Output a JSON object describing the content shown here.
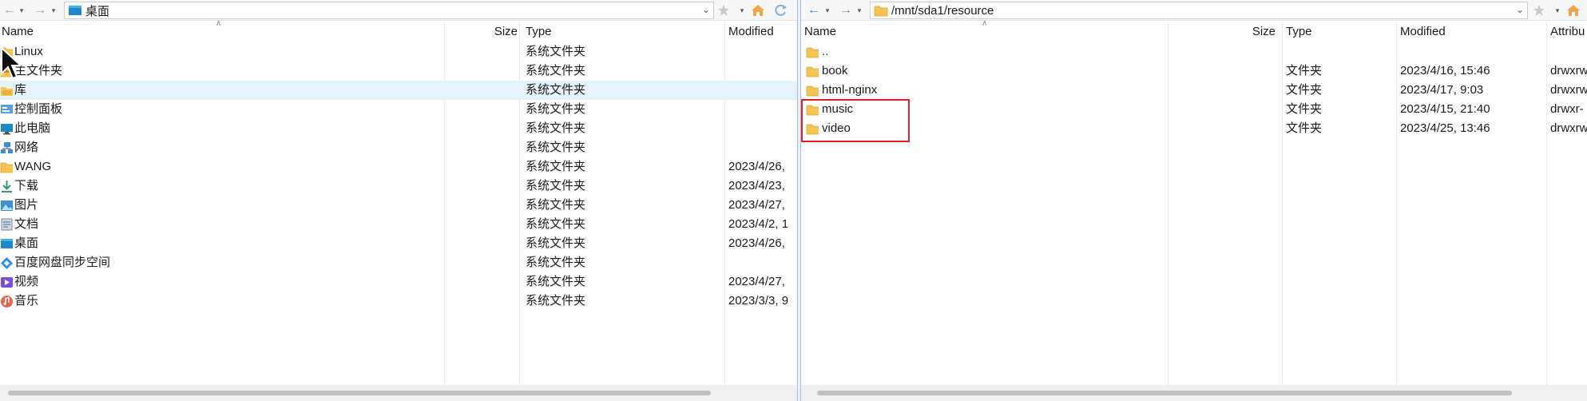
{
  "left": {
    "address": "桌面",
    "columns": {
      "name": "Name",
      "size": "Size",
      "type": "Type",
      "modified": "Modified"
    },
    "rows": [
      {
        "name": "Linux",
        "size": "",
        "type": "系统文件夹",
        "modified": "",
        "icon": "folder-icon"
      },
      {
        "name": "主文件夹",
        "size": "",
        "type": "系统文件夹",
        "modified": "",
        "icon": "home-folder-icon"
      },
      {
        "name": "库",
        "size": "",
        "type": "系统文件夹",
        "modified": "",
        "icon": "library-icon"
      },
      {
        "name": "控制面板",
        "size": "",
        "type": "系统文件夹",
        "modified": "",
        "icon": "control-panel-icon"
      },
      {
        "name": "此电脑",
        "size": "",
        "type": "系统文件夹",
        "modified": "",
        "icon": "computer-icon"
      },
      {
        "name": "网络",
        "size": "",
        "type": "系统文件夹",
        "modified": "",
        "icon": "network-icon"
      },
      {
        "name": "WANG",
        "size": "",
        "type": "系统文件夹",
        "modified": "2023/4/26,",
        "icon": "folder-icon"
      },
      {
        "name": "下载",
        "size": "",
        "type": "系统文件夹",
        "modified": "2023/4/23,",
        "icon": "download-icon"
      },
      {
        "name": "图片",
        "size": "",
        "type": "系统文件夹",
        "modified": "2023/4/27,",
        "icon": "pictures-icon"
      },
      {
        "name": "文档",
        "size": "",
        "type": "系统文件夹",
        "modified": "2023/4/2, 1",
        "icon": "documents-icon"
      },
      {
        "name": "桌面",
        "size": "",
        "type": "系统文件夹",
        "modified": "2023/4/26,",
        "icon": "desktop-icon"
      },
      {
        "name": "百度网盘同步空间",
        "size": "",
        "type": "系统文件夹",
        "modified": "",
        "icon": "baidu-netdisk-icon"
      },
      {
        "name": "视频",
        "size": "",
        "type": "系统文件夹",
        "modified": "2023/4/27,",
        "icon": "videos-icon"
      },
      {
        "name": "音乐",
        "size": "",
        "type": "系统文件夹",
        "modified": "2023/3/3, 9",
        "icon": "music-icon"
      }
    ]
  },
  "right": {
    "address": "/mnt/sda1/resource",
    "columns": {
      "name": "Name",
      "size": "Size",
      "type": "Type",
      "modified": "Modified",
      "attributes": "Attribu"
    },
    "rows": [
      {
        "name": "..",
        "size": "",
        "type": "",
        "modified": "",
        "attributes": ""
      },
      {
        "name": "book",
        "size": "",
        "type": "文件夹",
        "modified": "2023/4/16, 15:46",
        "attributes": "drwxrw"
      },
      {
        "name": "html-nginx",
        "size": "",
        "type": "文件夹",
        "modified": "2023/4/17, 9:03",
        "attributes": "drwxrw"
      },
      {
        "name": "music",
        "size": "",
        "type": "文件夹",
        "modified": "2023/4/15, 21:40",
        "attributes": "drwxr-"
      },
      {
        "name": "video",
        "size": "",
        "type": "文件夹",
        "modified": "2023/4/25, 13:46",
        "attributes": "drwxrw"
      }
    ]
  },
  "colors": {
    "selection": "#e5f3fb",
    "highlight_box": "#e02020",
    "folder": "#f5c451",
    "accent": "#2d7fd3"
  }
}
